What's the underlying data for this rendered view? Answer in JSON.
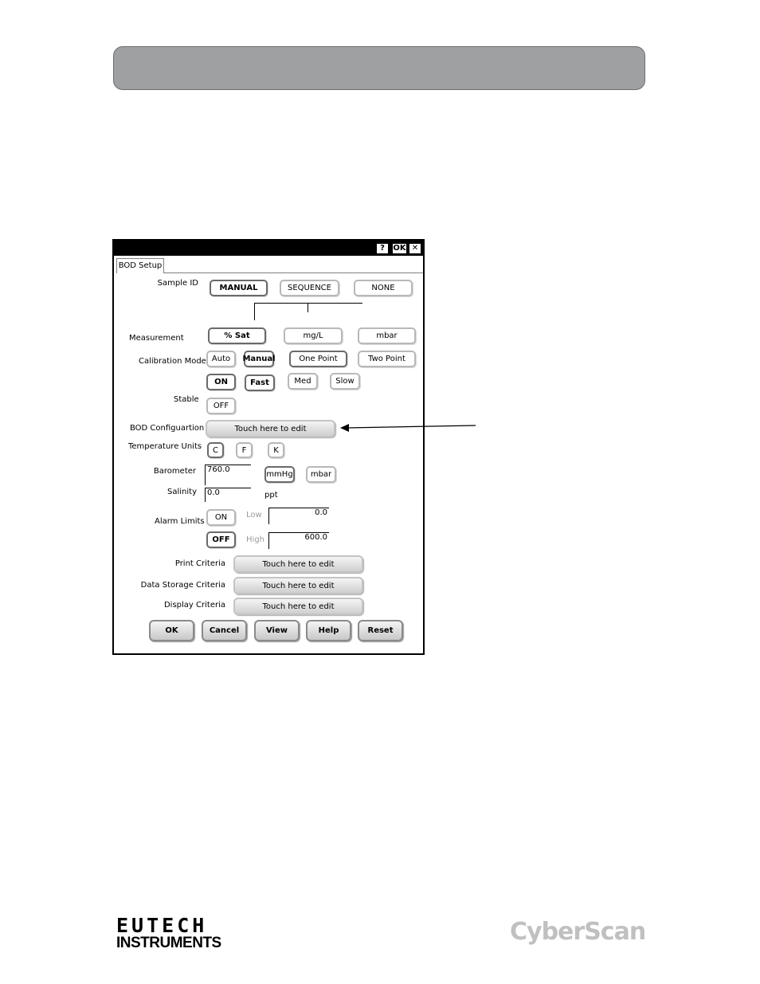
{
  "window": {
    "tb_help": "?",
    "tb_ok": "OK",
    "tb_close": "✕",
    "tab": "BOD Setup"
  },
  "labels": {
    "sample_id": "Sample ID",
    "measurement": "Measurement",
    "calibration_mode": "Calibration Mode",
    "stable": "Stable",
    "bod_config": "BOD Configuartion",
    "temperature_units": "Temperature Units",
    "barometer": "Barometer",
    "salinity": "Salinity",
    "ppt": "ppt",
    "alarm_limits": "Alarm Limits",
    "low": "Low",
    "high": "High",
    "print_criteria": "Print Criteria",
    "data_storage_criteria": "Data Storage Criteria",
    "display_criteria": "Display Criteria"
  },
  "sample_id": {
    "manual": "MANUAL",
    "sequence": "SEQUENCE",
    "none": "NONE"
  },
  "measurement": {
    "sat": "% Sat",
    "mgl": "mg/L",
    "mbar": "mbar"
  },
  "calibration": {
    "auto": "Auto",
    "manual": "Manual",
    "one_point": "One Point",
    "two_point": "Two Point"
  },
  "stable": {
    "on": "ON",
    "off": "OFF",
    "fast": "Fast",
    "med": "Med",
    "slow": "Slow"
  },
  "touch_edit": "Touch here to edit",
  "temp_units": {
    "c": "C",
    "f": "F",
    "k": "K"
  },
  "barometer": {
    "value": "760.0",
    "mmhg": "mmHg",
    "mbar": "mbar"
  },
  "salinity": {
    "value": "0.0"
  },
  "alarm": {
    "on": "ON",
    "off": "OFF",
    "low_value": "0.0",
    "high_value": "600.0"
  },
  "bottom_buttons": {
    "ok": "OK",
    "cancel": "Cancel",
    "view": "View",
    "help": "Help",
    "reset": "Reset"
  },
  "branding": {
    "eutech_top": "EUTECH",
    "eutech_bottom": "INSTRUMENTS",
    "cyberscan": "CyberScan"
  }
}
